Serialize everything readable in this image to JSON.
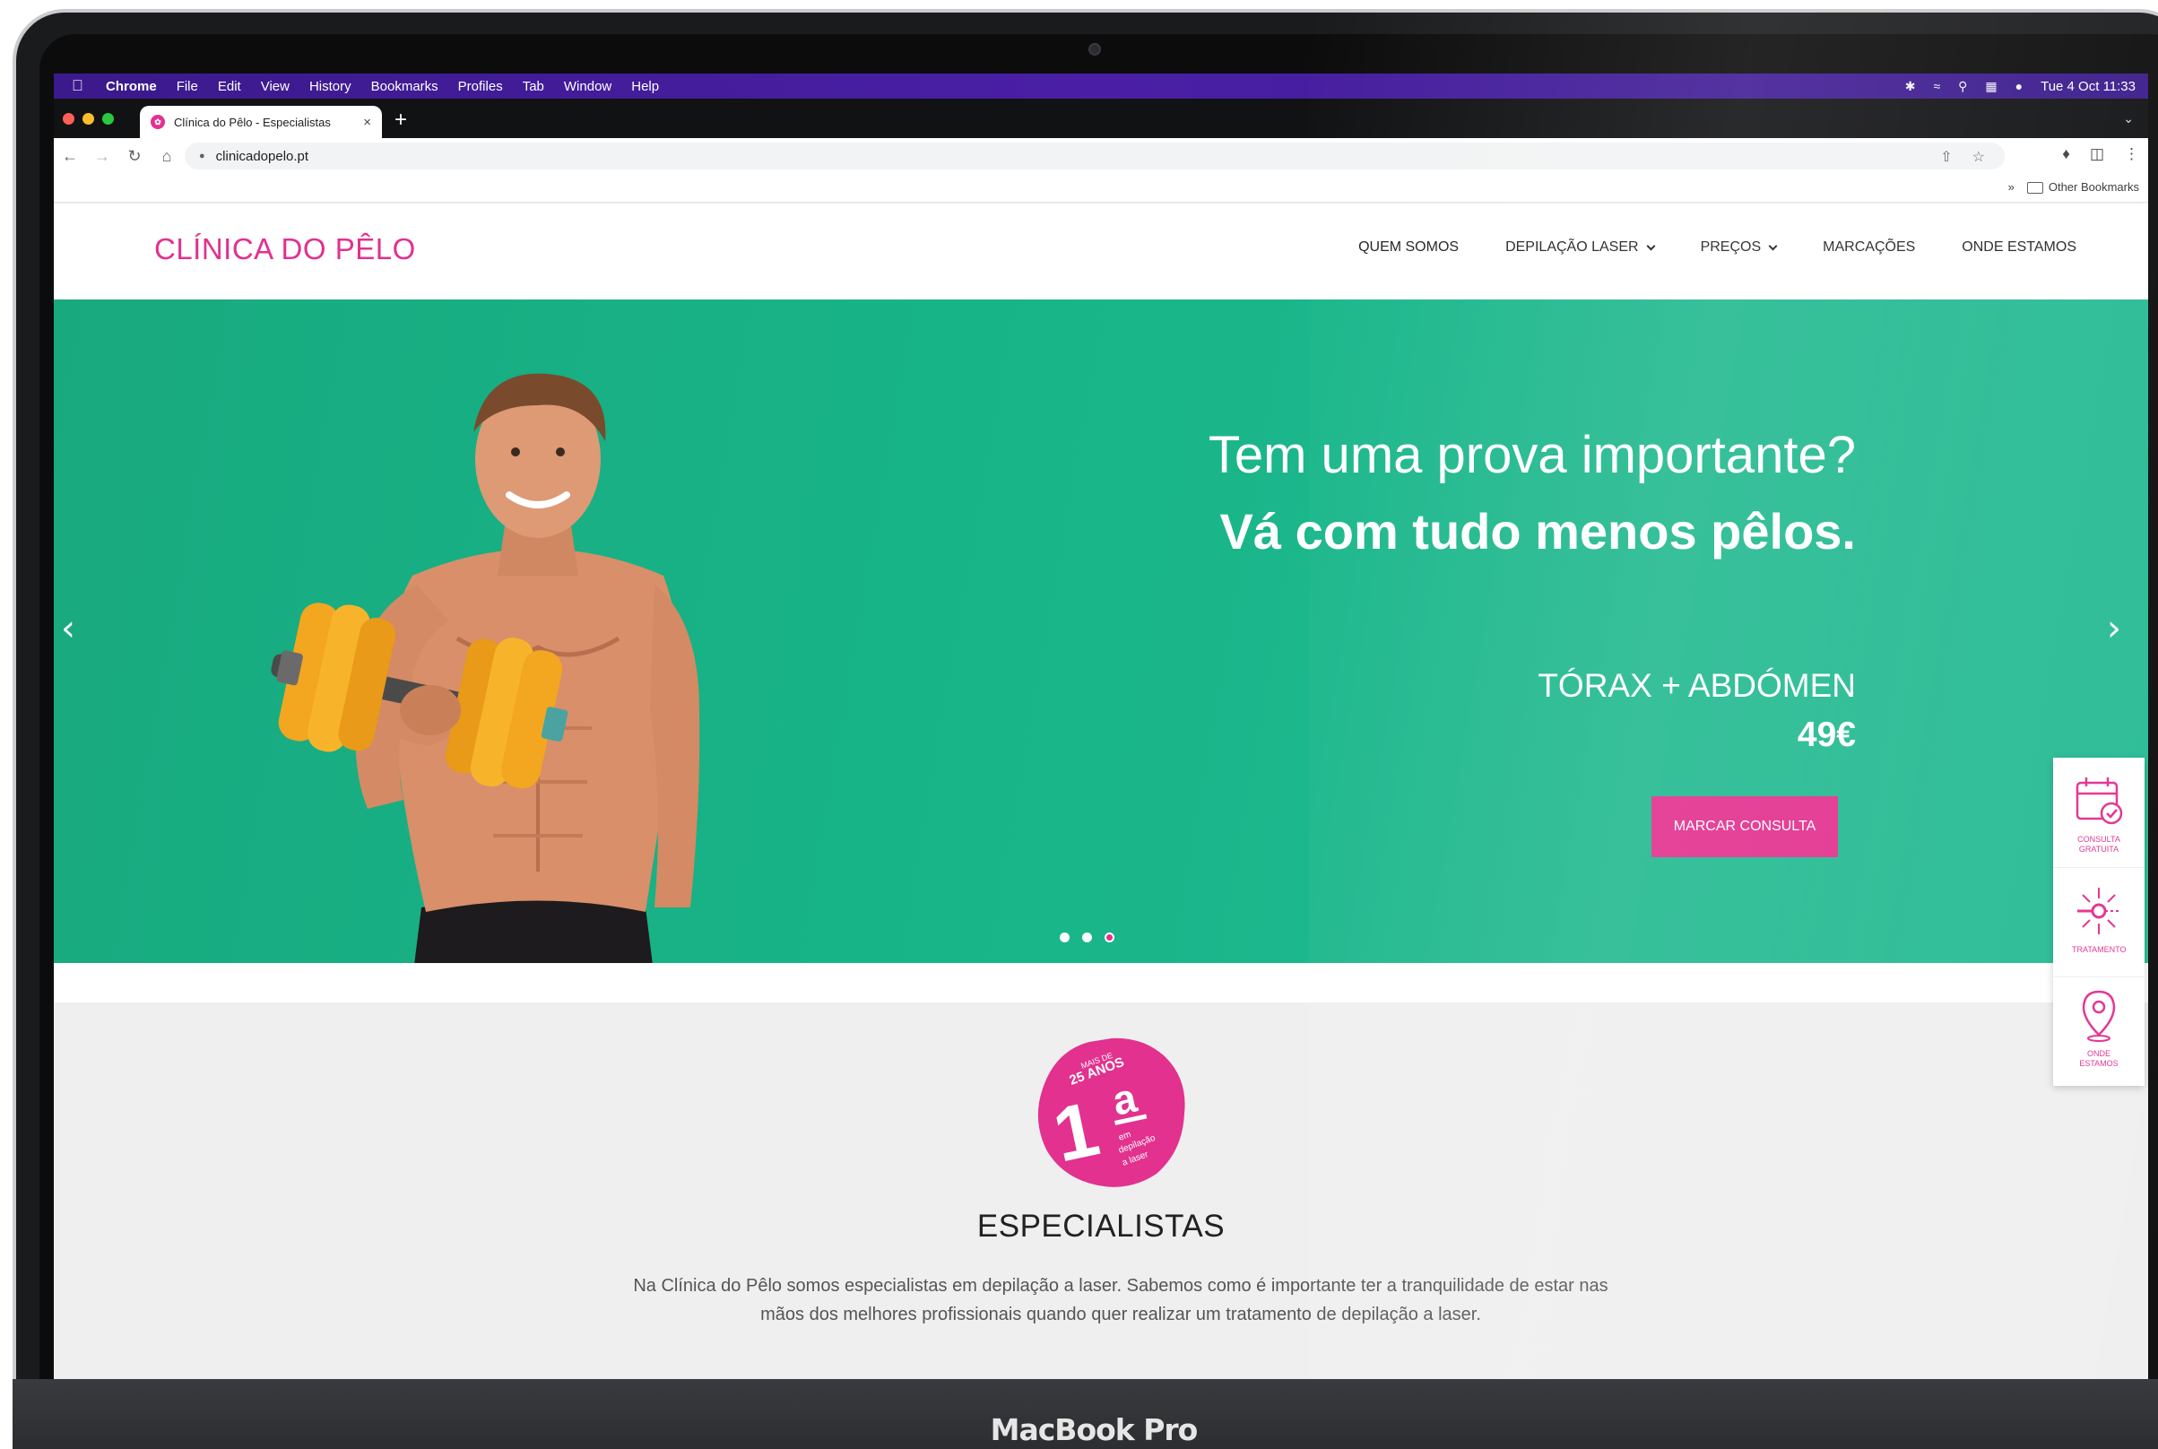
{
  "device": {
    "label": "MacBook Pro"
  },
  "menubar": {
    "app": "Chrome",
    "items": [
      "File",
      "Edit",
      "View",
      "History",
      "Bookmarks",
      "Profiles",
      "Tab",
      "Window",
      "Help"
    ],
    "clock": "Tue 4 Oct  11:33"
  },
  "browser": {
    "tab_title": "Clínica do Pêlo - Especialistas",
    "url": "clinicadopelo.pt",
    "bookmarks_folder": "Other Bookmarks",
    "bookmarks_more": "»"
  },
  "site": {
    "logo": "CLÍNICA DO PÊLO",
    "nav": [
      {
        "label": "QUEM SOMOS",
        "dropdown": false
      },
      {
        "label": "DEPILAÇÃO LASER",
        "dropdown": true
      },
      {
        "label": "PREÇOS",
        "dropdown": true
      },
      {
        "label": "MARCAÇÕES",
        "dropdown": false
      },
      {
        "label": "ONDE ESTAMOS",
        "dropdown": false
      }
    ],
    "hero": {
      "line1": "Tem uma prova importante?",
      "line2": "Vá com tudo menos pêlos.",
      "promo_area": "TÓRAX + ABDÓMEN",
      "promo_price": "49€",
      "cta": "MARCAR CONSULTA",
      "slides": 3,
      "active_slide": 3
    },
    "badge": {
      "top": "MAIS DE",
      "years": "25 ANOS",
      "rank": "1",
      "ordinal": "a",
      "caption": [
        "em",
        "depilação",
        "a laser"
      ]
    },
    "section": {
      "title": "ESPECIALISTAS",
      "text": "Na Clínica do Pêlo somos especialistas em depilação a laser. Sabemos como é importante ter a tranquilidade de estar nas mãos dos melhores profissionais quando quer realizar um tratamento de depilação a laser."
    },
    "side_widget": [
      {
        "label": "CONSULTA GRATUITA",
        "icon": "calendar-icon"
      },
      {
        "label": "TRATAMENTO",
        "icon": "laser-icon"
      },
      {
        "label": "ONDE ESTAMOS",
        "icon": "location-pin-icon"
      }
    ]
  },
  "colors": {
    "brand_pink": "#e2318e",
    "hero_green": "#17b588",
    "menubar_purple": "#4a1fa6"
  }
}
